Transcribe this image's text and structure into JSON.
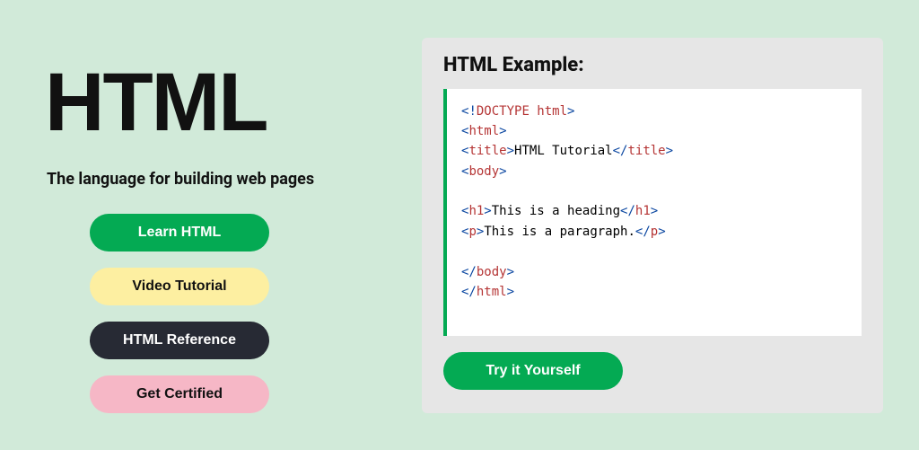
{
  "left": {
    "title": "HTML",
    "subtitle": "The language for building web pages",
    "buttons": {
      "learn": "Learn HTML",
      "video": "Video Tutorial",
      "reference": "HTML Reference",
      "certified": "Get Certified"
    }
  },
  "right": {
    "title": "HTML Example:",
    "try_label": "Try it Yourself",
    "code": {
      "doctype": "DOCTYPE html",
      "tag_html": "html",
      "tag_title": "title",
      "title_text": "HTML Tutorial",
      "tag_body": "body",
      "tag_h1": "h1",
      "h1_text": "This is a heading",
      "tag_p": "p",
      "p_text": "This is a paragraph.",
      "lt": "<",
      "gt": ">",
      "lts": "</",
      "excl": "!"
    }
  }
}
